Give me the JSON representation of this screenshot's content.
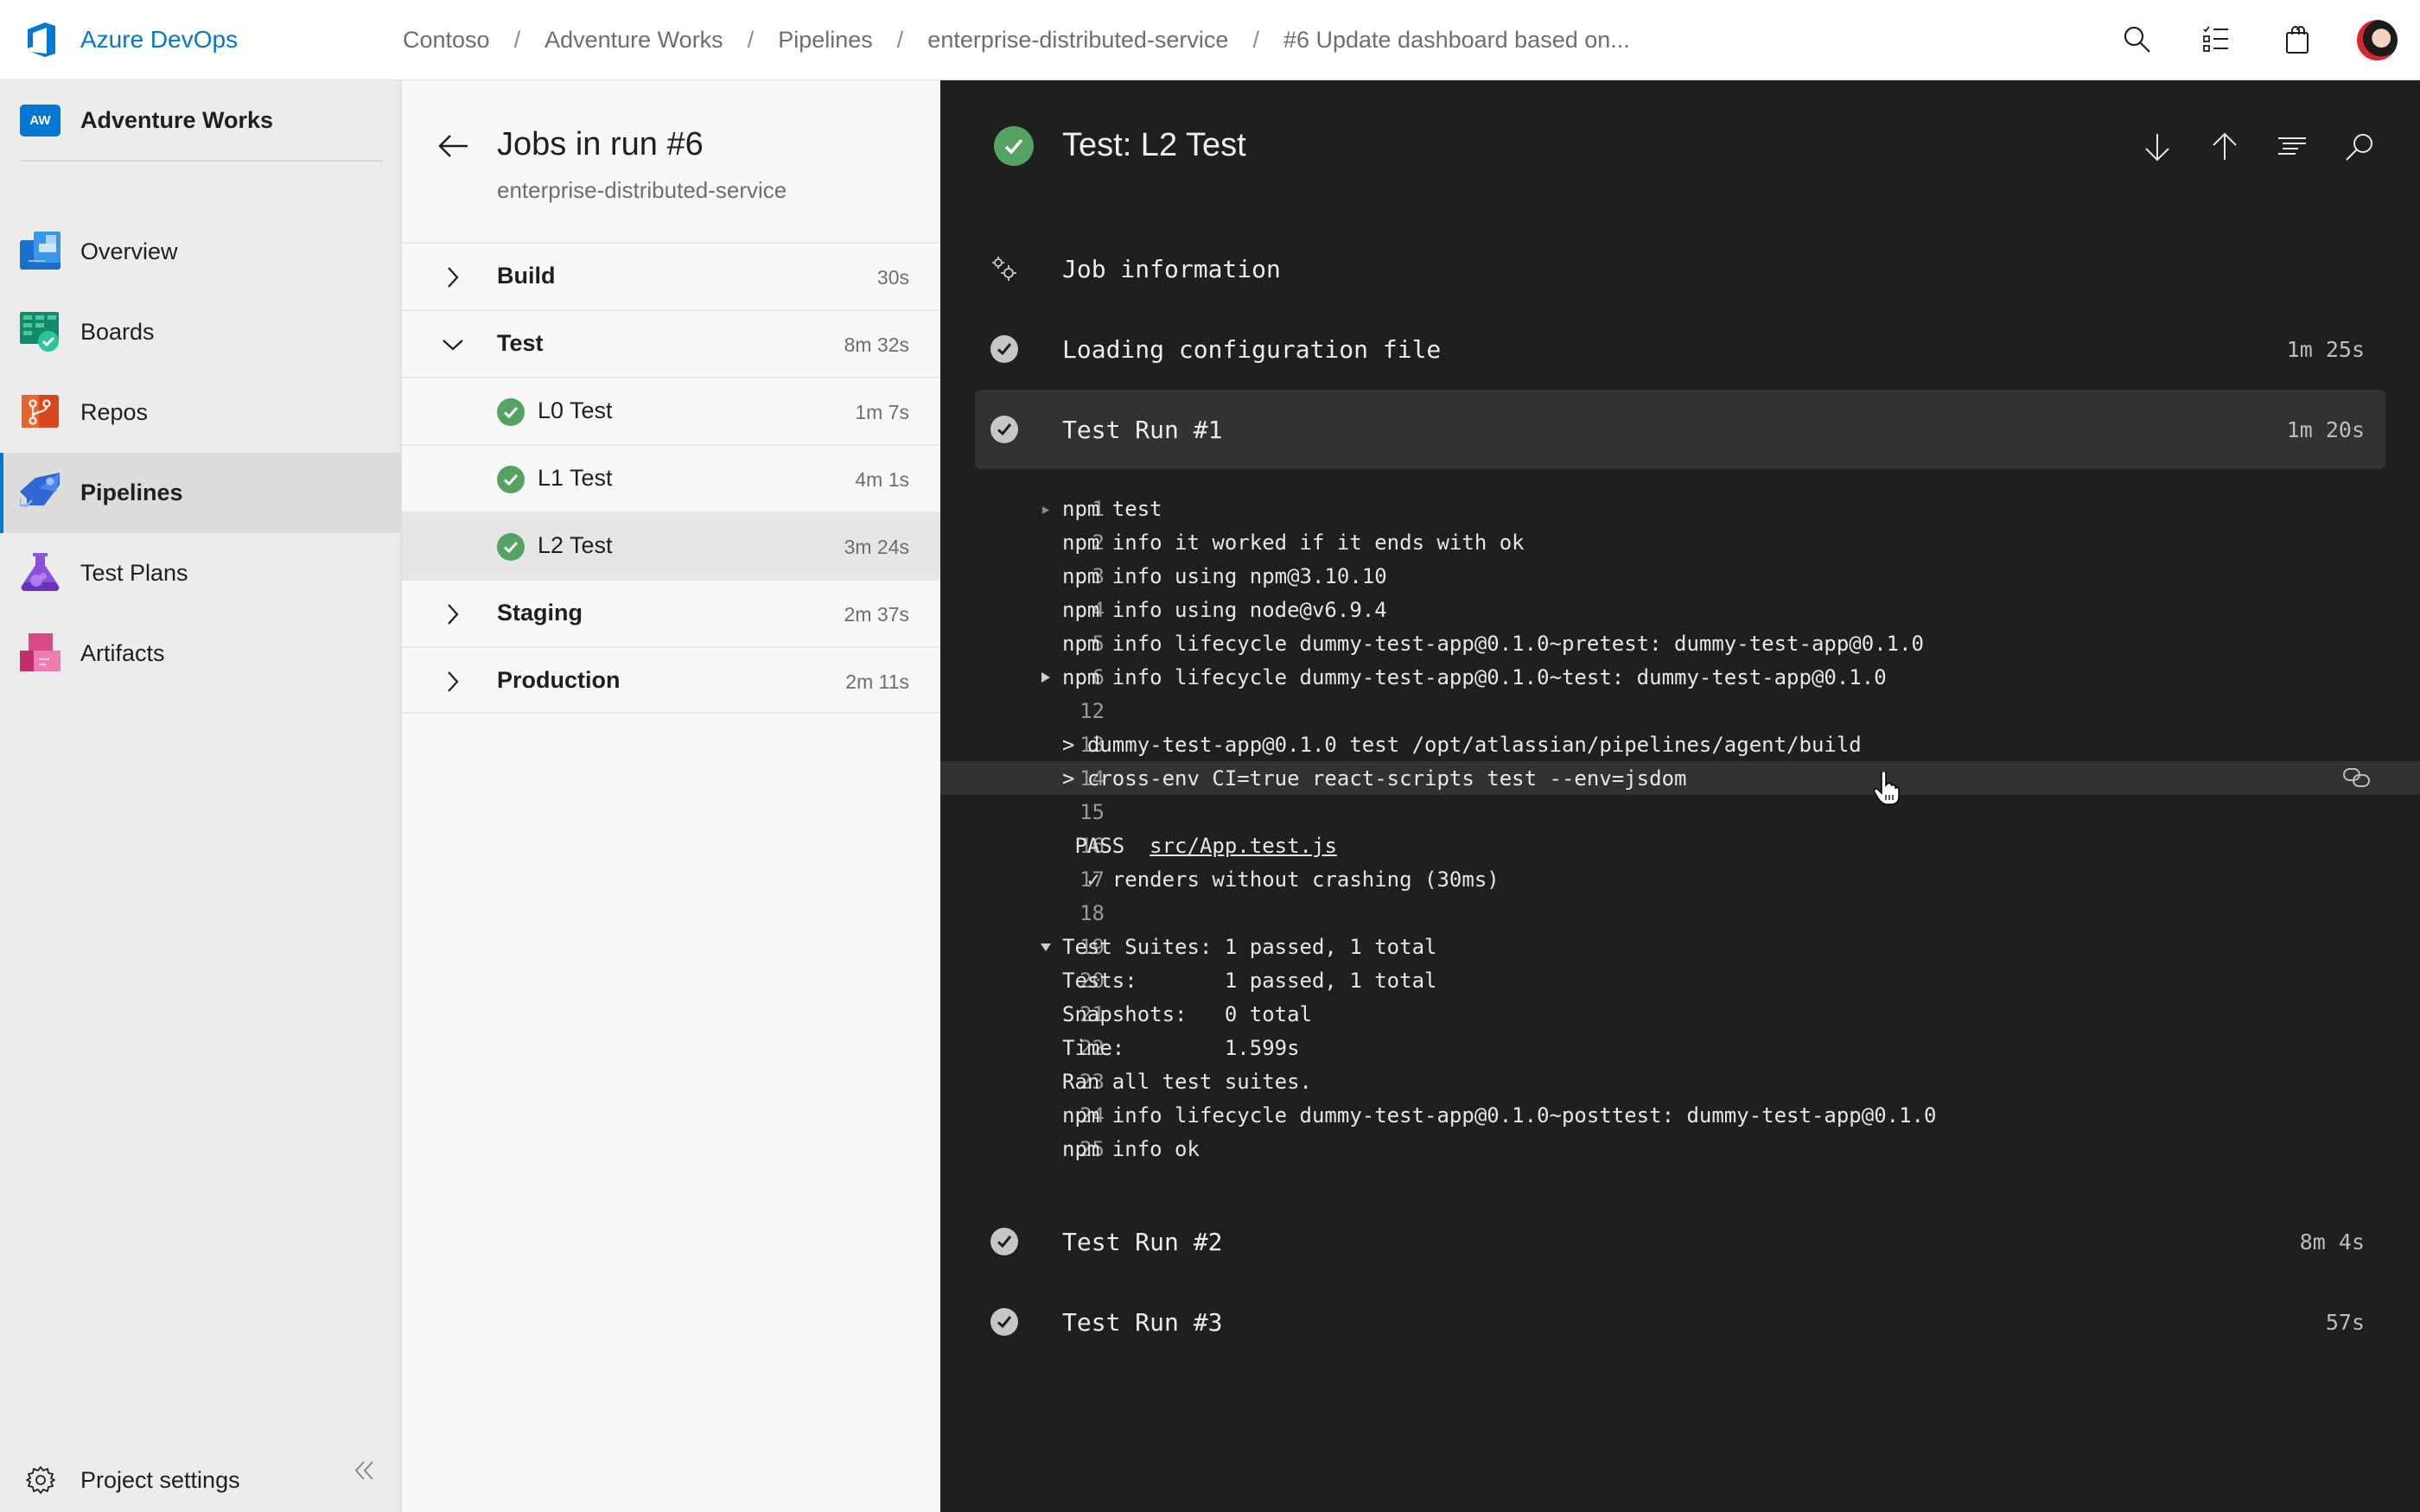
{
  "header": {
    "brand": "Azure DevOps",
    "breadcrumb": [
      "Contoso",
      "Adventure Works",
      "Pipelines",
      "enterprise-distributed-service",
      "#6 Update dashboard based on..."
    ],
    "breadcrumb_separator": "/",
    "icons": [
      "search-icon",
      "task-list-icon",
      "shopping-bag-icon",
      "user-avatar"
    ]
  },
  "sidebar": {
    "project": {
      "badge": "AW",
      "name": "Adventure Works"
    },
    "items": [
      {
        "label": "Overview",
        "icon": "overview-icon",
        "selected": false
      },
      {
        "label": "Boards",
        "icon": "boards-icon",
        "selected": false
      },
      {
        "label": "Repos",
        "icon": "repos-icon",
        "selected": false
      },
      {
        "label": "Pipelines",
        "icon": "pipelines-icon",
        "selected": true
      },
      {
        "label": "Test Plans",
        "icon": "test-plans-icon",
        "selected": false
      },
      {
        "label": "Artifacts",
        "icon": "artifacts-icon",
        "selected": false
      }
    ],
    "settings_label": "Project settings"
  },
  "jobs": {
    "title": "Jobs in run #6",
    "subtitle": "enterprise-distributed-service",
    "rows": [
      {
        "name": "Build",
        "duration": "30s",
        "type": "stage",
        "expanded": false
      },
      {
        "name": "Test",
        "duration": "8m 32s",
        "type": "stage",
        "expanded": true
      },
      {
        "name": "L0 Test",
        "duration": "1m 7s",
        "type": "job",
        "status": "succeeded"
      },
      {
        "name": "L1 Test",
        "duration": "4m 1s",
        "type": "job",
        "status": "succeeded"
      },
      {
        "name": "L2 Test",
        "duration": "3m 24s",
        "type": "job",
        "status": "succeeded",
        "selected": true
      },
      {
        "name": "Staging",
        "duration": "2m 37s",
        "type": "stage",
        "expanded": false
      },
      {
        "name": "Production",
        "duration": "2m 11s",
        "type": "stage",
        "expanded": false
      }
    ]
  },
  "log": {
    "title": "Test: L2 Test",
    "status": "succeeded",
    "toolbar": [
      "scroll-down-icon",
      "scroll-up-icon",
      "filter-icon",
      "search-icon"
    ],
    "steps_before": [
      {
        "title": "Job information",
        "duration": "",
        "icon": "gears-icon"
      },
      {
        "title": "Loading configuration file",
        "duration": "1m 25s",
        "icon": "check-icon"
      },
      {
        "title": "Test Run #1",
        "duration": "1m 20s",
        "icon": "check-icon",
        "open": true
      }
    ],
    "lines": [
      {
        "n": "1",
        "text": "npm test",
        "marker": "collapsed-small"
      },
      {
        "n": "2",
        "text": "npm info it worked if it ends with ok"
      },
      {
        "n": "3",
        "text": "npm info using npm@3.10.10"
      },
      {
        "n": "4",
        "text": "npm info using node@v6.9.4"
      },
      {
        "n": "5",
        "text": "npm info lifecycle dummy-test-app@0.1.0~pretest: dummy-test-app@0.1.0"
      },
      {
        "n": "6",
        "text": "npm info lifecycle dummy-test-app@0.1.0~test: dummy-test-app@0.1.0",
        "marker": "collapsed"
      },
      {
        "n": "12",
        "text": ""
      },
      {
        "n": "13",
        "text": "> dummy-test-app@0.1.0 test /opt/atlassian/pipelines/agent/build"
      },
      {
        "n": "14",
        "text": "> cross-env CI=true react-scripts test --env=jsdom",
        "highlighted": true
      },
      {
        "n": "15",
        "text": ""
      },
      {
        "n": "16",
        "text": " PASS  ",
        "link": "src/App.test.js"
      },
      {
        "n": "17",
        "text": "  ✓ renders without crashing (30ms)"
      },
      {
        "n": "18",
        "text": ""
      },
      {
        "n": "19",
        "text": "Test Suites: 1 passed, 1 total",
        "marker": "expanded"
      },
      {
        "n": "20",
        "text": "Tests:       1 passed, 1 total"
      },
      {
        "n": "21",
        "text": "Snapshots:   0 total"
      },
      {
        "n": "22",
        "text": "Time:        1.599s"
      },
      {
        "n": "23",
        "text": "Ran all test suites."
      },
      {
        "n": "24",
        "text": "npm info lifecycle dummy-test-app@0.1.0~posttest: dummy-test-app@0.1.0"
      },
      {
        "n": "25",
        "text": "npm info ok"
      }
    ],
    "steps_after": [
      {
        "title": "Test Run #2",
        "duration": "8m 4s",
        "icon": "check-icon"
      },
      {
        "title": "Test Run #3",
        "duration": "57s",
        "icon": "check-icon"
      }
    ]
  },
  "colors": {
    "accent": "#0078d4",
    "success": "#55a362",
    "log_bg": "#1f1f1f",
    "log_step_open_bg": "#323232"
  }
}
